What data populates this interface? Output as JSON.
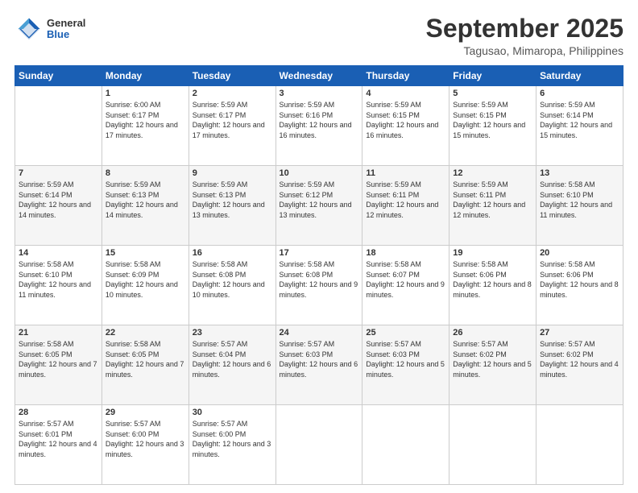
{
  "header": {
    "logo": {
      "general": "General",
      "blue": "Blue"
    },
    "title": "September 2025",
    "subtitle": "Tagusao, Mimaropa, Philippines"
  },
  "days_of_week": [
    "Sunday",
    "Monday",
    "Tuesday",
    "Wednesday",
    "Thursday",
    "Friday",
    "Saturday"
  ],
  "weeks": [
    [
      {
        "day": "",
        "sunrise": "",
        "sunset": "",
        "daylight": ""
      },
      {
        "day": "1",
        "sunrise": "Sunrise: 6:00 AM",
        "sunset": "Sunset: 6:17 PM",
        "daylight": "Daylight: 12 hours and 17 minutes."
      },
      {
        "day": "2",
        "sunrise": "Sunrise: 5:59 AM",
        "sunset": "Sunset: 6:17 PM",
        "daylight": "Daylight: 12 hours and 17 minutes."
      },
      {
        "day": "3",
        "sunrise": "Sunrise: 5:59 AM",
        "sunset": "Sunset: 6:16 PM",
        "daylight": "Daylight: 12 hours and 16 minutes."
      },
      {
        "day": "4",
        "sunrise": "Sunrise: 5:59 AM",
        "sunset": "Sunset: 6:15 PM",
        "daylight": "Daylight: 12 hours and 16 minutes."
      },
      {
        "day": "5",
        "sunrise": "Sunrise: 5:59 AM",
        "sunset": "Sunset: 6:15 PM",
        "daylight": "Daylight: 12 hours and 15 minutes."
      },
      {
        "day": "6",
        "sunrise": "Sunrise: 5:59 AM",
        "sunset": "Sunset: 6:14 PM",
        "daylight": "Daylight: 12 hours and 15 minutes."
      }
    ],
    [
      {
        "day": "7",
        "sunrise": "Sunrise: 5:59 AM",
        "sunset": "Sunset: 6:14 PM",
        "daylight": "Daylight: 12 hours and 14 minutes."
      },
      {
        "day": "8",
        "sunrise": "Sunrise: 5:59 AM",
        "sunset": "Sunset: 6:13 PM",
        "daylight": "Daylight: 12 hours and 14 minutes."
      },
      {
        "day": "9",
        "sunrise": "Sunrise: 5:59 AM",
        "sunset": "Sunset: 6:13 PM",
        "daylight": "Daylight: 12 hours and 13 minutes."
      },
      {
        "day": "10",
        "sunrise": "Sunrise: 5:59 AM",
        "sunset": "Sunset: 6:12 PM",
        "daylight": "Daylight: 12 hours and 13 minutes."
      },
      {
        "day": "11",
        "sunrise": "Sunrise: 5:59 AM",
        "sunset": "Sunset: 6:11 PM",
        "daylight": "Daylight: 12 hours and 12 minutes."
      },
      {
        "day": "12",
        "sunrise": "Sunrise: 5:59 AM",
        "sunset": "Sunset: 6:11 PM",
        "daylight": "Daylight: 12 hours and 12 minutes."
      },
      {
        "day": "13",
        "sunrise": "Sunrise: 5:58 AM",
        "sunset": "Sunset: 6:10 PM",
        "daylight": "Daylight: 12 hours and 11 minutes."
      }
    ],
    [
      {
        "day": "14",
        "sunrise": "Sunrise: 5:58 AM",
        "sunset": "Sunset: 6:10 PM",
        "daylight": "Daylight: 12 hours and 11 minutes."
      },
      {
        "day": "15",
        "sunrise": "Sunrise: 5:58 AM",
        "sunset": "Sunset: 6:09 PM",
        "daylight": "Daylight: 12 hours and 10 minutes."
      },
      {
        "day": "16",
        "sunrise": "Sunrise: 5:58 AM",
        "sunset": "Sunset: 6:08 PM",
        "daylight": "Daylight: 12 hours and 10 minutes."
      },
      {
        "day": "17",
        "sunrise": "Sunrise: 5:58 AM",
        "sunset": "Sunset: 6:08 PM",
        "daylight": "Daylight: 12 hours and 9 minutes."
      },
      {
        "day": "18",
        "sunrise": "Sunrise: 5:58 AM",
        "sunset": "Sunset: 6:07 PM",
        "daylight": "Daylight: 12 hours and 9 minutes."
      },
      {
        "day": "19",
        "sunrise": "Sunrise: 5:58 AM",
        "sunset": "Sunset: 6:06 PM",
        "daylight": "Daylight: 12 hours and 8 minutes."
      },
      {
        "day": "20",
        "sunrise": "Sunrise: 5:58 AM",
        "sunset": "Sunset: 6:06 PM",
        "daylight": "Daylight: 12 hours and 8 minutes."
      }
    ],
    [
      {
        "day": "21",
        "sunrise": "Sunrise: 5:58 AM",
        "sunset": "Sunset: 6:05 PM",
        "daylight": "Daylight: 12 hours and 7 minutes."
      },
      {
        "day": "22",
        "sunrise": "Sunrise: 5:58 AM",
        "sunset": "Sunset: 6:05 PM",
        "daylight": "Daylight: 12 hours and 7 minutes."
      },
      {
        "day": "23",
        "sunrise": "Sunrise: 5:57 AM",
        "sunset": "Sunset: 6:04 PM",
        "daylight": "Daylight: 12 hours and 6 minutes."
      },
      {
        "day": "24",
        "sunrise": "Sunrise: 5:57 AM",
        "sunset": "Sunset: 6:03 PM",
        "daylight": "Daylight: 12 hours and 6 minutes."
      },
      {
        "day": "25",
        "sunrise": "Sunrise: 5:57 AM",
        "sunset": "Sunset: 6:03 PM",
        "daylight": "Daylight: 12 hours and 5 minutes."
      },
      {
        "day": "26",
        "sunrise": "Sunrise: 5:57 AM",
        "sunset": "Sunset: 6:02 PM",
        "daylight": "Daylight: 12 hours and 5 minutes."
      },
      {
        "day": "27",
        "sunrise": "Sunrise: 5:57 AM",
        "sunset": "Sunset: 6:02 PM",
        "daylight": "Daylight: 12 hours and 4 minutes."
      }
    ],
    [
      {
        "day": "28",
        "sunrise": "Sunrise: 5:57 AM",
        "sunset": "Sunset: 6:01 PM",
        "daylight": "Daylight: 12 hours and 4 minutes."
      },
      {
        "day": "29",
        "sunrise": "Sunrise: 5:57 AM",
        "sunset": "Sunset: 6:00 PM",
        "daylight": "Daylight: 12 hours and 3 minutes."
      },
      {
        "day": "30",
        "sunrise": "Sunrise: 5:57 AM",
        "sunset": "Sunset: 6:00 PM",
        "daylight": "Daylight: 12 hours and 3 minutes."
      },
      {
        "day": "",
        "sunrise": "",
        "sunset": "",
        "daylight": ""
      },
      {
        "day": "",
        "sunrise": "",
        "sunset": "",
        "daylight": ""
      },
      {
        "day": "",
        "sunrise": "",
        "sunset": "",
        "daylight": ""
      },
      {
        "day": "",
        "sunrise": "",
        "sunset": "",
        "daylight": ""
      }
    ]
  ]
}
